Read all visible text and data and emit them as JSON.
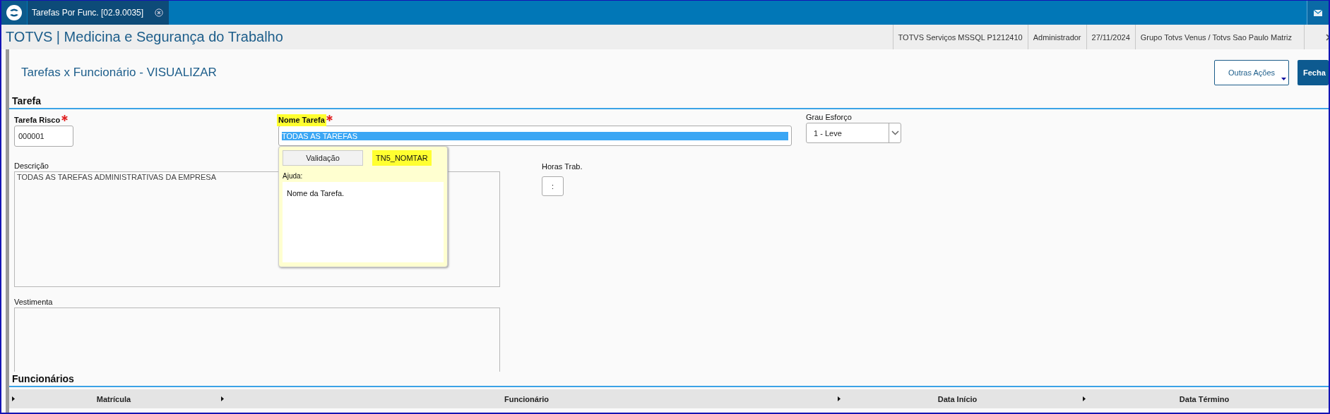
{
  "tab_bar": {
    "tabs": [
      {
        "label": "Tarefas Por Func. [02.9.0035]",
        "selected": true
      }
    ]
  },
  "header": {
    "title": "TOTVS | Medicina e Segurança do Trabalho",
    "info": [
      "TOTVS Serviços MSSQL P1212410",
      "Administrador",
      "27/11/2024",
      "Grupo Totvs Venus / Totvs Sao Paulo Matriz"
    ]
  },
  "page": {
    "title": "Tarefas x Funcionário - VISUALIZAR",
    "actions": [
      {
        "label": "Outras Ações",
        "kind": "dropdown"
      },
      {
        "label": "Fecha",
        "kind": "primary"
      }
    ]
  },
  "section_tarefa": {
    "title": "Tarefa"
  },
  "tarefa_risco": {
    "label": "Tarefa Risco",
    "required": true,
    "highlighted": false,
    "value": "000001"
  },
  "nome_tarefa": {
    "label": "Nome Tarefa",
    "required": true,
    "highlighted": true,
    "value": "TODAS AS TAREFAS",
    "text_selected": true
  },
  "grau_esforco": {
    "label": "Grau Esforço",
    "required": false,
    "highlighted": false,
    "value": "1 - Leve"
  },
  "help_popup": {
    "button": "Validação",
    "field_id": "TN5_NOMTAR",
    "field_id_highlighted": true,
    "help_label": "Ajuda:",
    "help_text": "Nome da Tarefa."
  },
  "descricao": {
    "label": "Descrição",
    "required": false,
    "highlighted": false,
    "value": "TODAS AS TAREFAS ADMINISTRATIVAS DA EMPRESA"
  },
  "horas_trab": {
    "label": "Horas Trab.",
    "required": false,
    "highlighted": false,
    "value": ":"
  },
  "vestimenta": {
    "label": "Vestimenta",
    "required": false,
    "highlighted": false
  },
  "funcionarios": {
    "title": "Funcionários",
    "columns": [
      "Matrícula",
      "Funcionário",
      "Data Início",
      "Data Término"
    ]
  }
}
